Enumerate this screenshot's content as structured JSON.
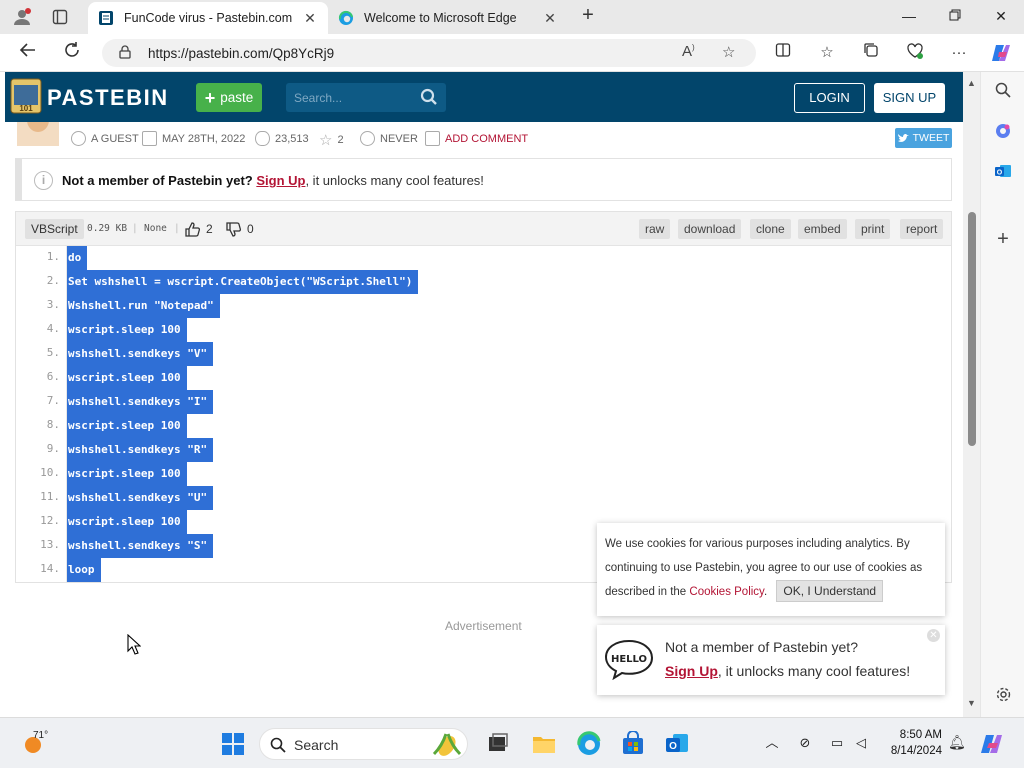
{
  "browser": {
    "tabs": [
      {
        "title": "FunCode virus - Pastebin.com",
        "active": true
      },
      {
        "title": "Welcome to Microsoft Edge",
        "active": false
      }
    ],
    "url": "https://pastebin.com/Qp8YcRj9"
  },
  "pastebin": {
    "brand": "PASTEBIN",
    "logo_text": "PASTE 101",
    "paste_button": "paste",
    "search_placeholder": "Search...",
    "login": "LOGIN",
    "signup": "SIGN UP",
    "meta": {
      "author": "A GUEST",
      "date": "MAY 28TH, 2022",
      "views": "23,513",
      "stars": "2",
      "expires": "NEVER",
      "add_comment": "ADD COMMENT"
    },
    "tweet": "TWEET",
    "notice": {
      "bold": "Not a member of Pastebin yet?",
      "link": "Sign Up",
      "rest": ", it unlocks many cool features!"
    },
    "code": {
      "language": "VBScript",
      "size": "0.29 KB",
      "category": "None",
      "likes": "2",
      "dislikes": "0",
      "actions": [
        "raw",
        "download",
        "clone",
        "embed",
        "print",
        "report"
      ],
      "lines": [
        "do",
        "Set wshshell = wscript.CreateObject(\"WScript.Shell\")",
        "Wshshell.run \"Notepad\"",
        "wscript.sleep 100",
        "wshshell.sendkeys \"V\"",
        "wscript.sleep 100",
        "wshshell.sendkeys \"I\"",
        "wscript.sleep 100",
        "wshshell.sendkeys \"R\"",
        "wscript.sleep 100",
        "wshshell.sendkeys \"U\"",
        "wscript.sleep 100",
        "wshshell.sendkeys \"S\"",
        "loop"
      ]
    },
    "advertisement": "Advertisement",
    "cookie": {
      "text": "We use cookies for various purposes including analytics. By continuing to use Pastebin, you agree to our use of cookies as described in the ",
      "link": "Cookies Policy",
      "after": ".",
      "button": "OK, I Understand"
    },
    "popup": {
      "line1": "Not a member of Pastebin yet?",
      "link": "Sign Up",
      "rest": ", it unlocks many cool features!",
      "hello": "HELLO"
    }
  },
  "taskbar": {
    "temperature": "71°",
    "search": "Search",
    "time": "8:50 AM",
    "date": "8/14/2024"
  },
  "colors": {
    "pastebin_header": "#02456b",
    "paste_green": "#47b14a",
    "selection_blue": "#2f6fd6",
    "link_red": "#b31535",
    "tweet_blue": "#4aa3df"
  }
}
